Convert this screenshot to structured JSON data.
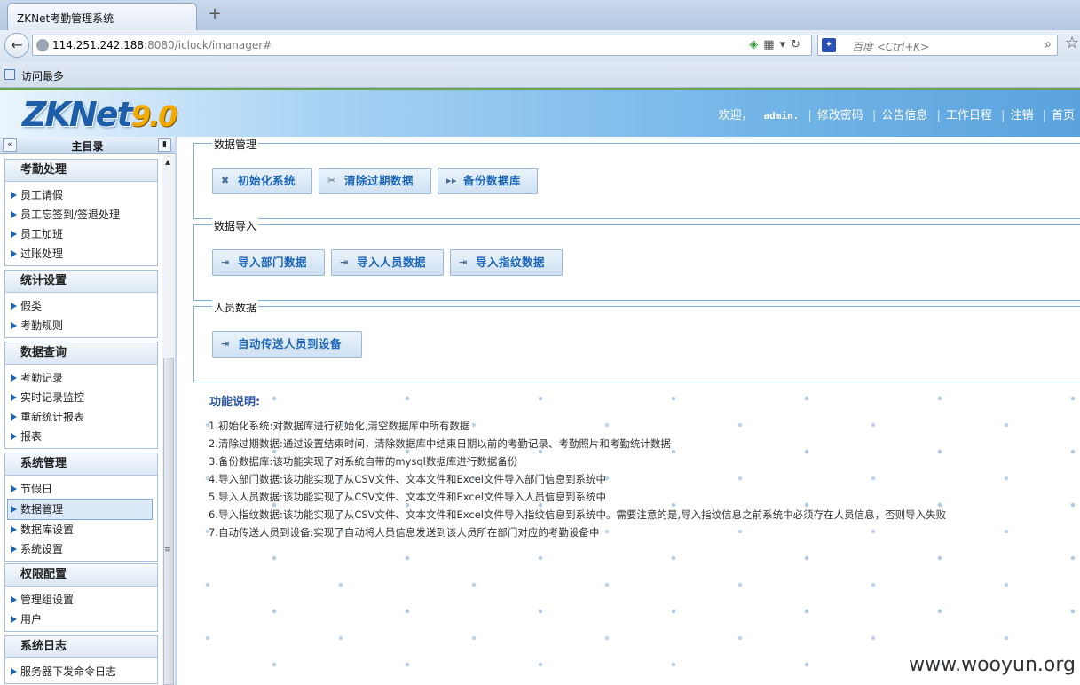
{
  "browser": {
    "tab_title": "ZKNet考勤管理系统",
    "new_tab": "+",
    "url_host": "114.251.242.188",
    "url_rest": ":8080/iclock/imanager#",
    "search_placeholder": "百度 <Ctrl+K>",
    "bookmark_label": "访问最多"
  },
  "header": {
    "logo_text": "ZKNet",
    "logo_version": "9.0",
    "welcome": "欢迎，",
    "username": "admin.",
    "links": [
      "修改密码",
      "公告信息",
      "工作日程",
      "注销",
      "首页"
    ]
  },
  "sidebar": {
    "title": "主目录",
    "groups": [
      {
        "title": "考勤处理",
        "items": [
          "员工请假",
          "员工忘签到/签退处理",
          "员工加班",
          "过账处理"
        ]
      },
      {
        "title": "统计设置",
        "items": [
          "假类",
          "考勤规则"
        ]
      },
      {
        "title": "数据查询",
        "items": [
          "考勤记录",
          "实时记录监控",
          "重新统计报表",
          "报表"
        ]
      },
      {
        "title": "系统管理",
        "items": [
          "节假日",
          "数据管理",
          "数据库设置",
          "系统设置"
        ]
      },
      {
        "title": "权限配置",
        "items": [
          "管理组设置",
          "用户"
        ]
      },
      {
        "title": "系统日志",
        "items": [
          "服务器下发命令日志"
        ]
      }
    ],
    "active_item": "数据管理"
  },
  "main": {
    "sections": [
      {
        "legend": "数据管理",
        "buttons": [
          "初始化系统",
          "清除过期数据",
          "备份数据库"
        ]
      },
      {
        "legend": "数据导入",
        "buttons": [
          "导入部门数据",
          "导入人员数据",
          "导入指纹数据"
        ]
      },
      {
        "legend": "人员数据",
        "buttons": [
          "自动传送人员到设备"
        ]
      }
    ],
    "desc_title": "功能说明:",
    "desc_lines": [
      "1.初始化系统:对数据库进行初始化,清空数据库中所有数据",
      "2.清除过期数据:通过设置结束时间，清除数据库中结束日期以前的考勤记录、考勤照片和考勤统计数据",
      "3.备份数据库:该功能实现了对系统自带的mysql数据库进行数据备份",
      "4.导入部门数据:该功能实现了从CSV文件、文本文件和Excel文件导入部门信息到系统中",
      "5.导入人员数据:该功能实现了从CSV文件、文本文件和Excel文件导入人员信息到系统中",
      "6.导入指纹数据:该功能实现了从CSV文件、文本文件和Excel文件导入指纹信息到系统中。需要注意的是,导入指纹信息之前系统中必须存在人员信息，否则导入失败",
      "7.自动传送人员到设备:实现了自动将人员信息发送到该人员所在部门对应的考勤设备中"
    ],
    "watermark": "www.wooyun.org"
  }
}
